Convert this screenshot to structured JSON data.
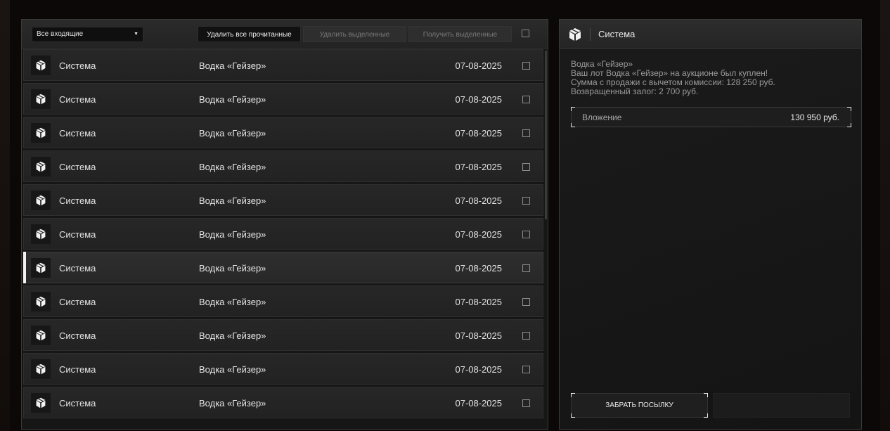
{
  "toolbar": {
    "filter_value": "Все входящие",
    "delete_read_label": "Удалить все прочитанные",
    "delete_selected_label": "Удалить выделенные",
    "get_selected_label": "Получить выделенные"
  },
  "messages": [
    {
      "sender": "Система",
      "subject": "Водка «Гейзер»",
      "date": "07-08-2025",
      "icon": "package-icon",
      "selected": false
    },
    {
      "sender": "Система",
      "subject": "Водка «Гейзер»",
      "date": "07-08-2025",
      "icon": "package-icon",
      "selected": false
    },
    {
      "sender": "Система",
      "subject": "Водка «Гейзер»",
      "date": "07-08-2025",
      "icon": "package-icon",
      "selected": false
    },
    {
      "sender": "Система",
      "subject": "Водка «Гейзер»",
      "date": "07-08-2025",
      "icon": "package-icon",
      "selected": false
    },
    {
      "sender": "Система",
      "subject": "Водка «Гейзер»",
      "date": "07-08-2025",
      "icon": "package-icon",
      "selected": false
    },
    {
      "sender": "Система",
      "subject": "Водка «Гейзер»",
      "date": "07-08-2025",
      "icon": "package-icon",
      "selected": false
    },
    {
      "sender": "Система",
      "subject": "Водка «Гейзер»",
      "date": "07-08-2025",
      "icon": "package-icon",
      "selected": true
    },
    {
      "sender": "Система",
      "subject": "Водка «Гейзер»",
      "date": "07-08-2025",
      "icon": "package-icon",
      "selected": false
    },
    {
      "sender": "Система",
      "subject": "Водка «Гейзер»",
      "date": "07-08-2025",
      "icon": "package-icon",
      "selected": false
    },
    {
      "sender": "Система",
      "subject": "Водка «Гейзер»",
      "date": "07-08-2025",
      "icon": "package-icon",
      "selected": false
    },
    {
      "sender": "Система",
      "subject": "Водка «Гейзер»",
      "date": "07-08-2025",
      "icon": "package-icon",
      "selected": false
    }
  ],
  "detail": {
    "sender": "Система",
    "icon": "package-icon",
    "lines": [
      "Водка «Гейзер»",
      "Ваш лот Водка «Гейзер» на аукционе был куплен!",
      "Сумма с продажи с вычетом комиссии: 128 250 руб.",
      "Возвращенный залог: 2 700 руб."
    ],
    "attachment_label": "Вложение",
    "attachment_value": "130 950 руб.",
    "take_button_label": "ЗАБРАТЬ ПОСЫЛКУ"
  },
  "colors": {
    "background": "#0b0807",
    "panel": "#161616",
    "row": "#252525",
    "selected_marker": "#f2f2f2",
    "muted_text": "#9a9a9a"
  }
}
